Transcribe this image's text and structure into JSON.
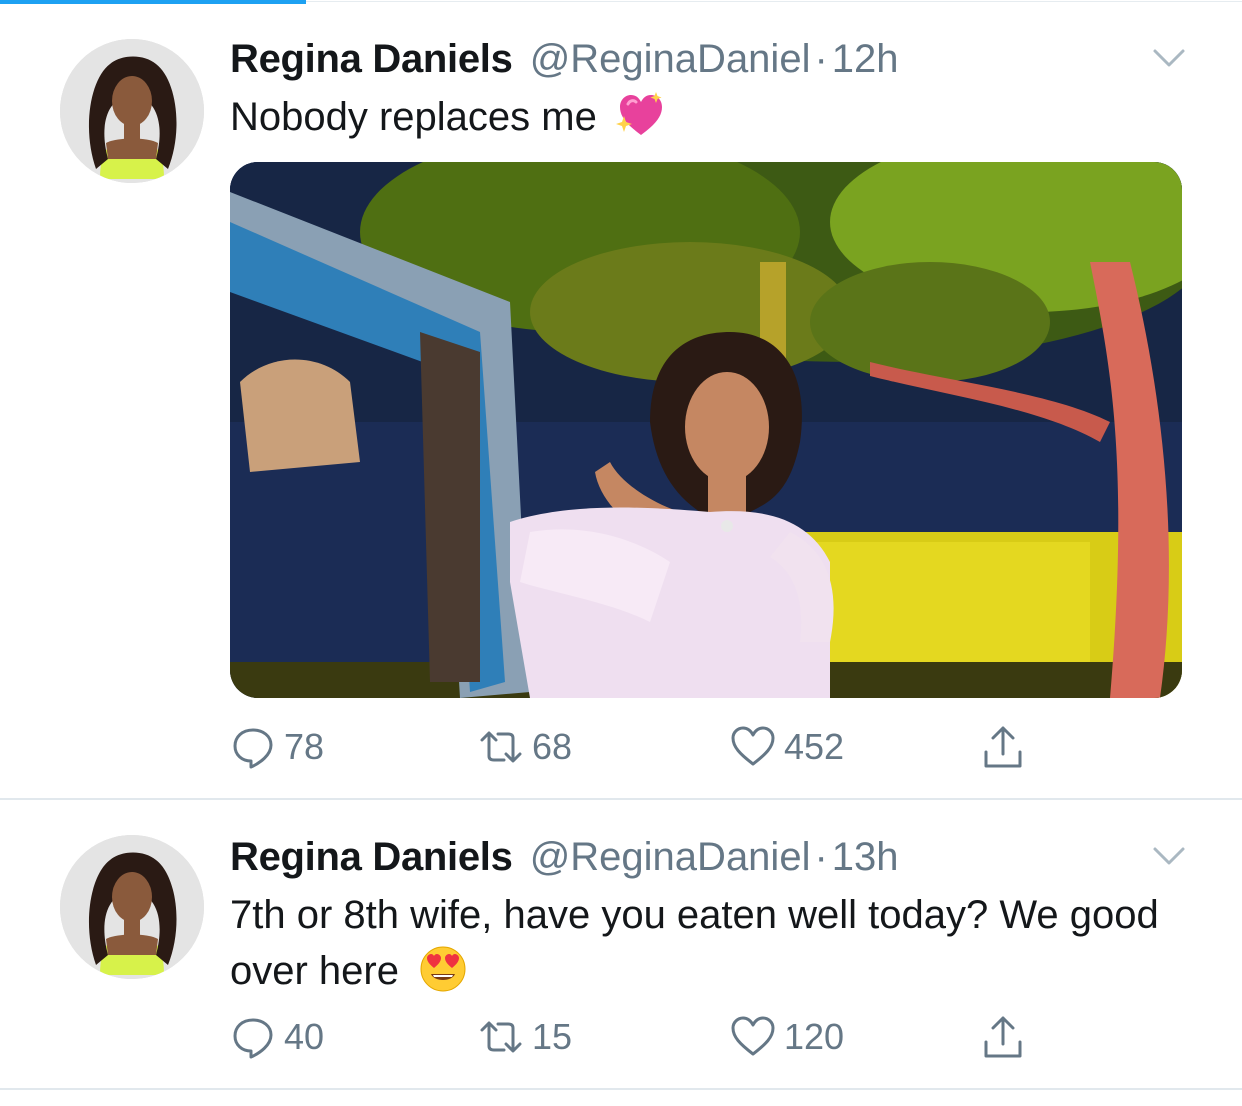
{
  "tweets": [
    {
      "display_name": "Regina Daniels",
      "handle": "@ReginaDaniel",
      "separator": "·",
      "time": "12h",
      "text": "Nobody replaces me",
      "emoji": "sparkling-heart",
      "has_media": true,
      "reply_count": "78",
      "retweet_count": "68",
      "like_count": "452"
    },
    {
      "display_name": "Regina Daniels",
      "handle": "@ReginaDaniel",
      "separator": "·",
      "time": "13h",
      "text": "7th or 8th wife, have you eaten well today? We good over here",
      "emoji": "heart-eyes",
      "has_media": false,
      "reply_count": "40",
      "retweet_count": "15",
      "like_count": "120"
    }
  ],
  "colors": {
    "accent": "#1da1f2",
    "secondary_text": "#657786",
    "primary_text": "#14171a",
    "divider": "#e1e8ed"
  }
}
